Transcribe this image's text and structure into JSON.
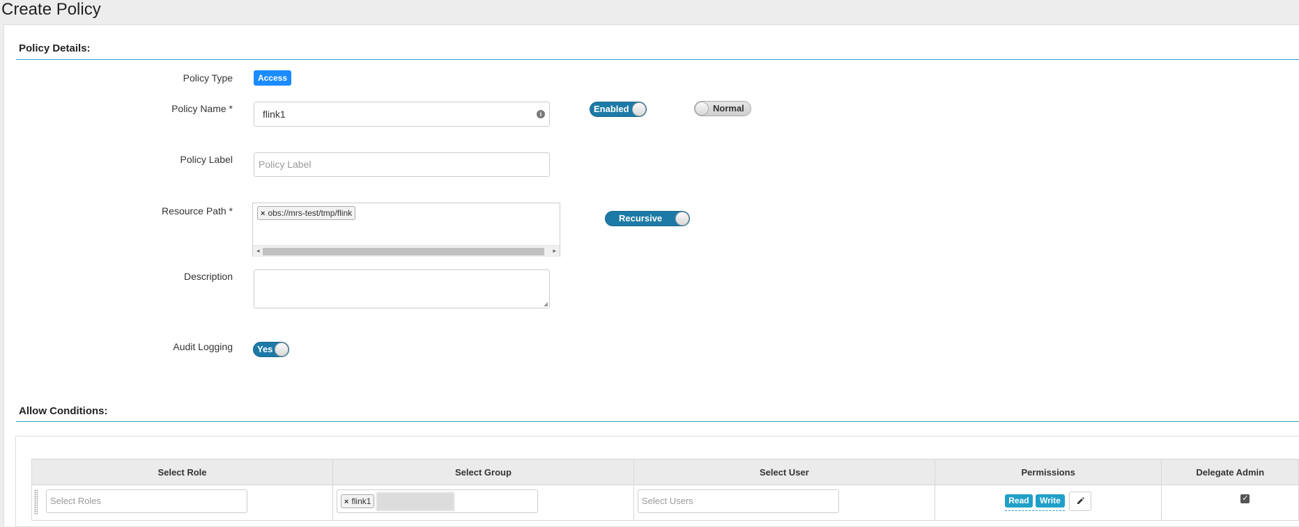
{
  "page": {
    "title": "Create Policy"
  },
  "sections": {
    "policy_details": "Policy Details:",
    "allow_conditions": "Allow Conditions:"
  },
  "form": {
    "policy_type": {
      "label": "Policy Type",
      "value": "Access"
    },
    "policy_name": {
      "label": "Policy Name *",
      "value": "flink1"
    },
    "enabled_toggle": "Enabled",
    "normal_toggle": "Normal",
    "policy_label": {
      "label": "Policy Label",
      "placeholder": "Policy Label"
    },
    "resource_path": {
      "label": "Resource Path *",
      "tags": [
        "obs://mrs-test/tmp/flink"
      ]
    },
    "recursive_toggle": "Recursive",
    "description": {
      "label": "Description",
      "value": ""
    },
    "audit_logging": {
      "label": "Audit Logging",
      "value": "Yes"
    }
  },
  "table": {
    "headers": [
      "Select Role",
      "Select Group",
      "Select User",
      "Permissions",
      "Delegate Admin"
    ],
    "row": {
      "role_placeholder": "Select Roles",
      "group_tag": "flink1",
      "user_placeholder": "Select Users",
      "permissions": [
        "Read",
        "Write"
      ],
      "delegate_admin": true
    }
  },
  "colors": {
    "accent": "#1d7aa6",
    "badge": "#1a8cff",
    "perm_badge": "#20a0c8",
    "rule": "#2aa3c9"
  }
}
